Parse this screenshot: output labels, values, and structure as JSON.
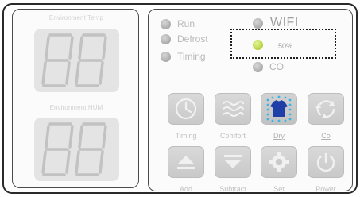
{
  "left_panel": {
    "temp_label": "Environment Temp",
    "hum_label": "Environment HUM"
  },
  "indicators": {
    "run": {
      "label": "Run",
      "state": "off"
    },
    "defrost": {
      "label": "Defrost",
      "state": "off"
    },
    "timing": {
      "label": "Timing",
      "state": "off"
    },
    "wifi": {
      "label": "WIFI",
      "state": "off"
    },
    "level": {
      "label": "50%",
      "state": "on"
    },
    "co": {
      "label": "CO",
      "state": "off"
    }
  },
  "buttons_row1": [
    {
      "label": "Timing",
      "icon": "clock-icon"
    },
    {
      "label": "Comfort",
      "icon": "wave-icon"
    },
    {
      "label": "Dry",
      "icon": "tshirt-icon",
      "active": true
    },
    {
      "label": "Co",
      "icon": "recycle-icon"
    }
  ],
  "buttons_row2": [
    {
      "label": "Add",
      "icon": "up-arrow-icon"
    },
    {
      "label": "Subtract",
      "icon": "down-arrow-icon"
    },
    {
      "label": "Set",
      "icon": "gear-icon"
    },
    {
      "label": "Power",
      "icon": "power-icon"
    }
  ],
  "colors": {
    "led_off": "#a9a9a9",
    "led_on": "#b6d640",
    "dry_icon": "#1f3fa8",
    "dry_dots": "#37b4e8"
  }
}
